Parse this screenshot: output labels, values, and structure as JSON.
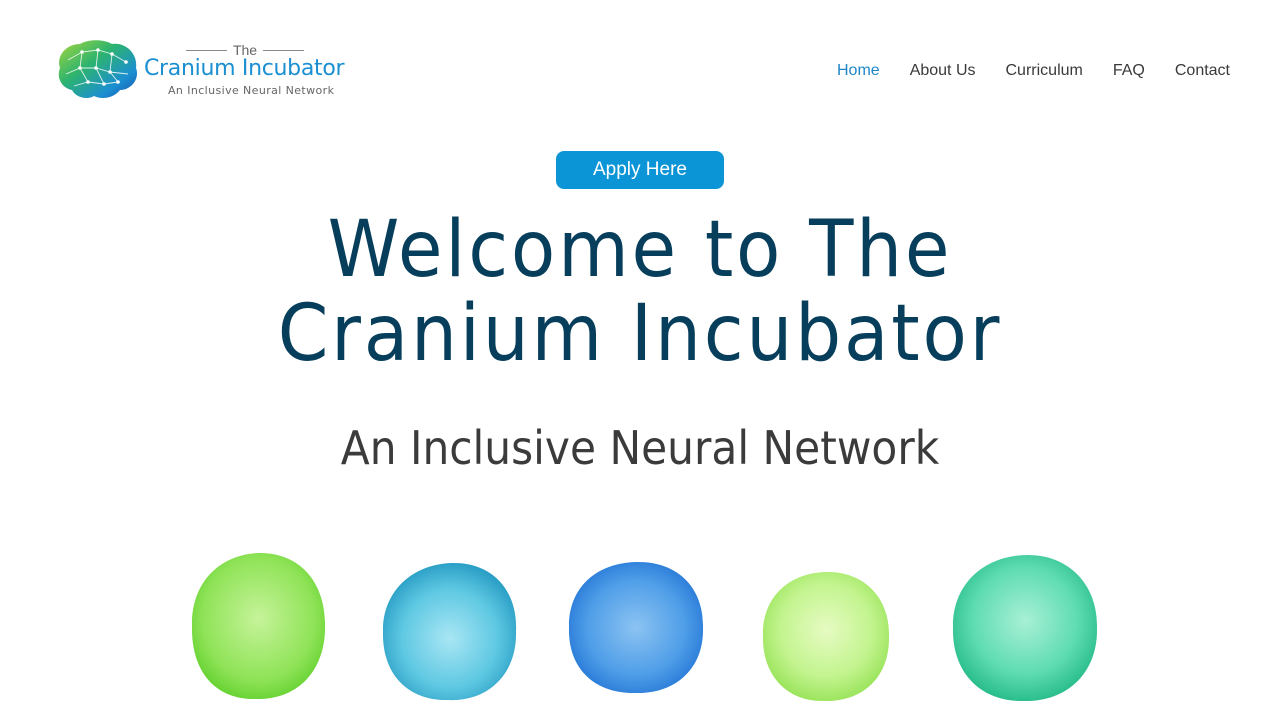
{
  "brand": {
    "the": "The",
    "name": "Cranium Incubator",
    "tagline": "An Inclusive Neural Network"
  },
  "nav": {
    "items": [
      {
        "label": "Home",
        "active": true
      },
      {
        "label": "About Us",
        "active": false
      },
      {
        "label": "Curriculum",
        "active": false
      },
      {
        "label": "FAQ",
        "active": false
      },
      {
        "label": "Contact",
        "active": false
      }
    ]
  },
  "hero": {
    "apply_label": "Apply Here",
    "title": "Welcome to The Cranium Incubator",
    "subtitle": "An Inclusive Neural Network"
  },
  "colors": {
    "accent": "#0c95d6",
    "nav_active": "#1e87c8",
    "title": "#063e5b",
    "circle_colors": [
      "#7fe04a",
      "#4fc0dd",
      "#3b8fe0",
      "#b9f07a",
      "#47d6a6"
    ]
  }
}
